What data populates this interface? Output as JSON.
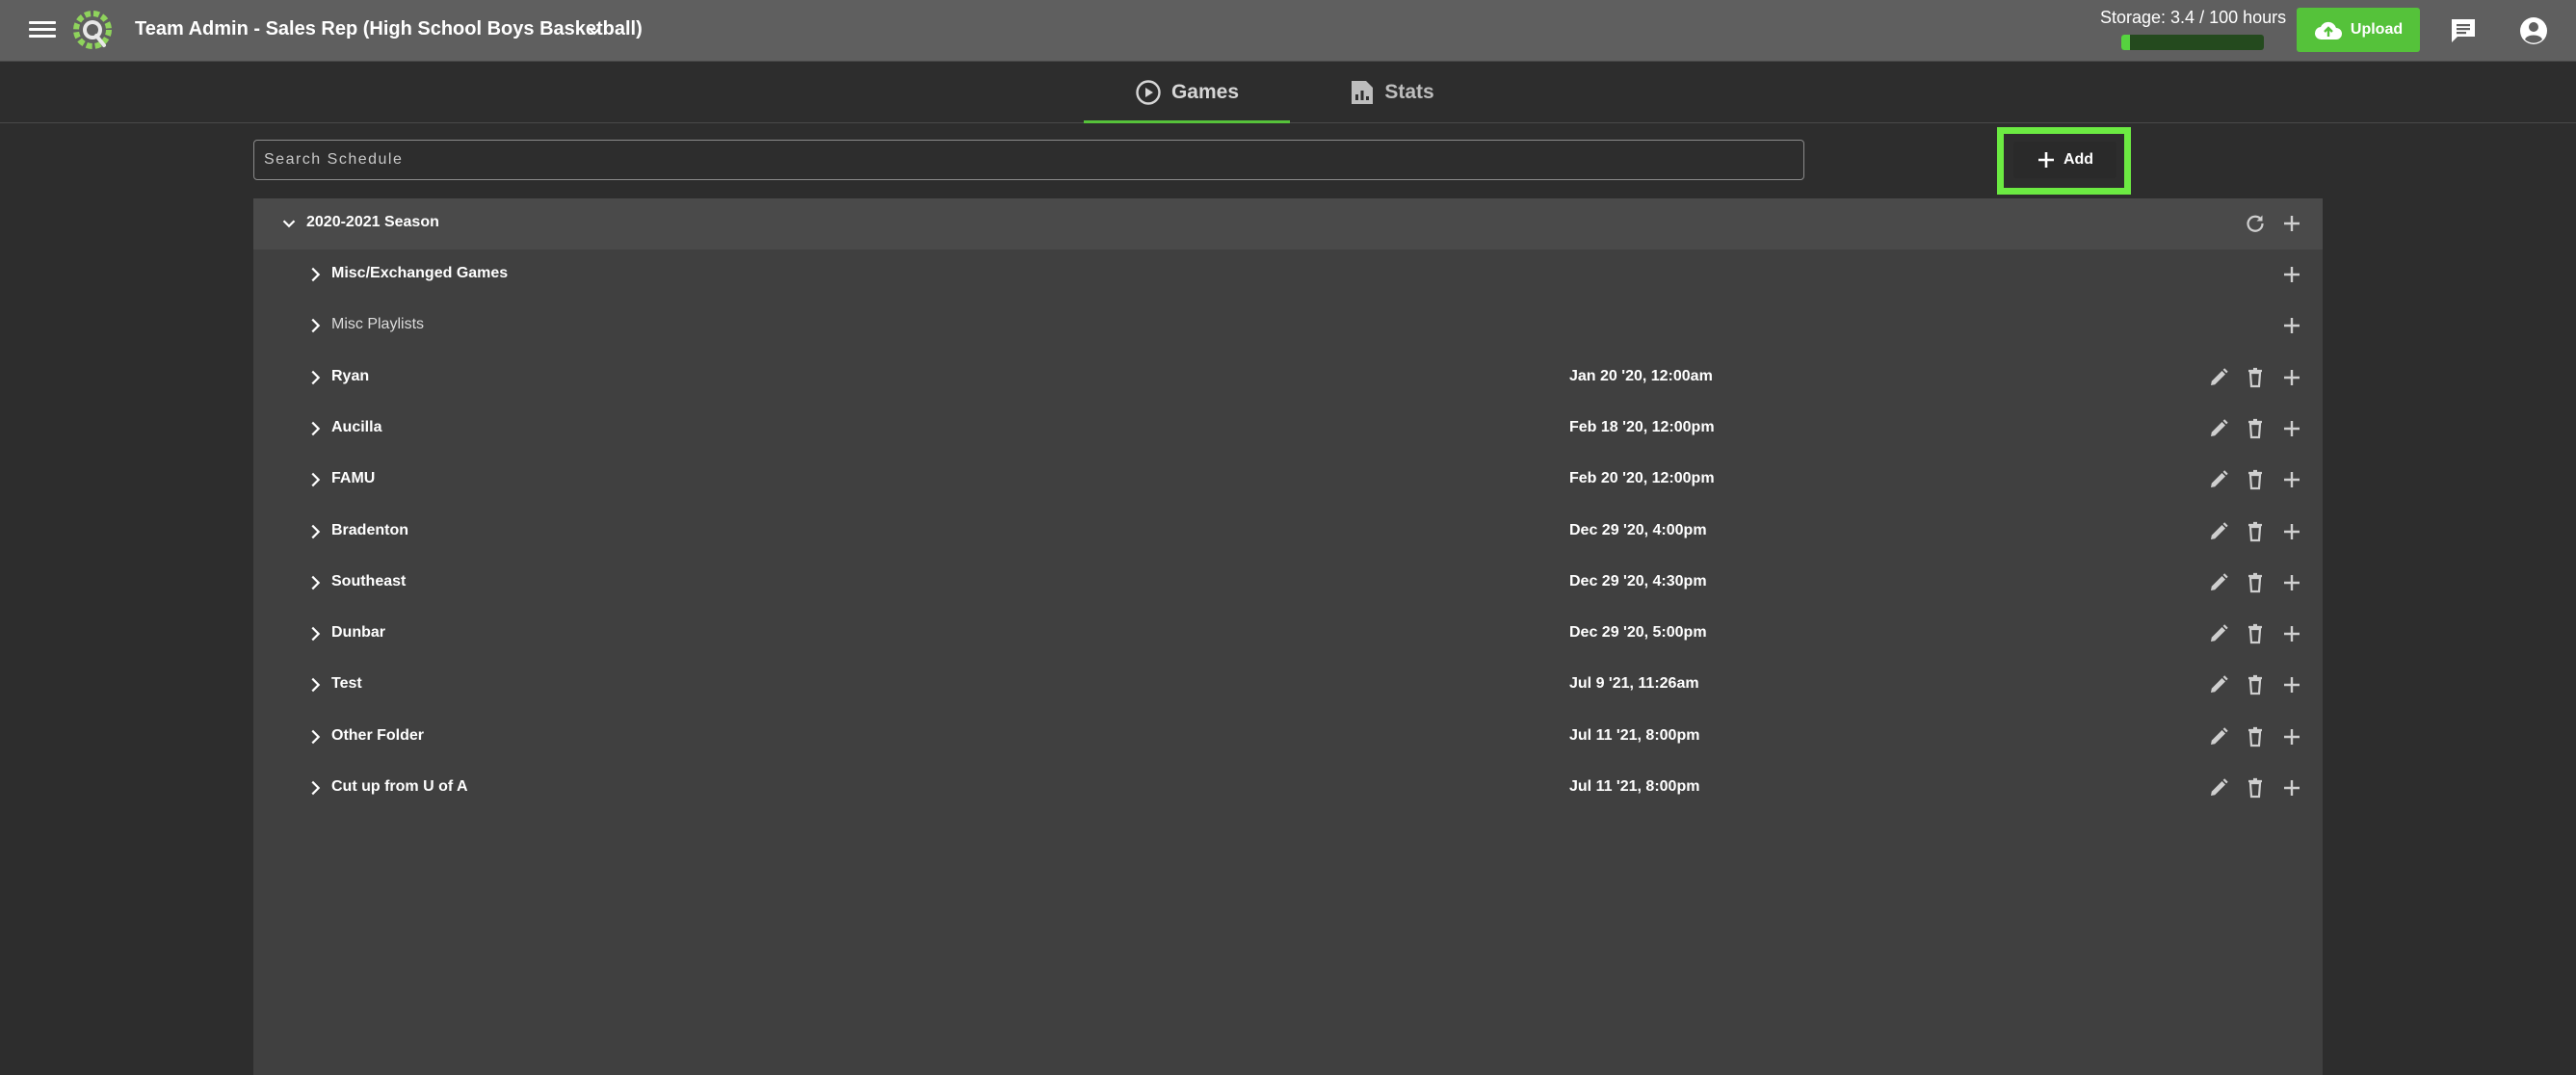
{
  "header": {
    "team_title": "Team Admin - Sales Rep (High School Boys Basketball)",
    "storage_text": "Storage: 3.4 / 100 hours",
    "storage_fraction": 0.034,
    "upload_label": "Upload",
    "icons": [
      "menu-icon",
      "app-logo",
      "chevron-down-icon",
      "cloud-upload-icon",
      "chat-icon",
      "account-circle-icon"
    ]
  },
  "tabs": [
    {
      "label": "Games",
      "icon": "play-circle-icon",
      "active": true
    },
    {
      "label": "Stats",
      "icon": "stats-sheet-icon",
      "active": false
    }
  ],
  "search": {
    "placeholder": "Search Schedule",
    "value": ""
  },
  "add_button": {
    "label": "Add",
    "highlighted": true
  },
  "season": {
    "label": "2020-2021 Season",
    "expanded": true
  },
  "folders": [
    {
      "label": "Misc/Exchanged Games",
      "date": ""
    },
    {
      "label": "Misc Playlists",
      "date": ""
    }
  ],
  "games": [
    {
      "label": "Ryan",
      "date": "Jan 20 '20, 12:00am"
    },
    {
      "label": "Aucilla",
      "date": "Feb 18 '20, 12:00pm"
    },
    {
      "label": "FAMU",
      "date": "Feb 20 '20, 12:00pm"
    },
    {
      "label": "Bradenton",
      "date": "Dec 29 '20, 4:00pm"
    },
    {
      "label": "Southeast",
      "date": "Dec 29 '20, 4:30pm"
    },
    {
      "label": "Dunbar",
      "date": "Dec 29 '20, 5:00pm"
    },
    {
      "label": "Test",
      "date": "Jul 9 '21, 11:26am"
    },
    {
      "label": "Other Folder",
      "date": "Jul 11 '21, 8:00pm"
    },
    {
      "label": "Cut up from U of A",
      "date": "Jul 11 '21, 8:00pm"
    }
  ],
  "colors": {
    "accent": "#56c23a",
    "highlight": "#6cea42",
    "topbar": "#5f5f5f",
    "background": "#2d2d2d",
    "list_background": "#404040"
  }
}
